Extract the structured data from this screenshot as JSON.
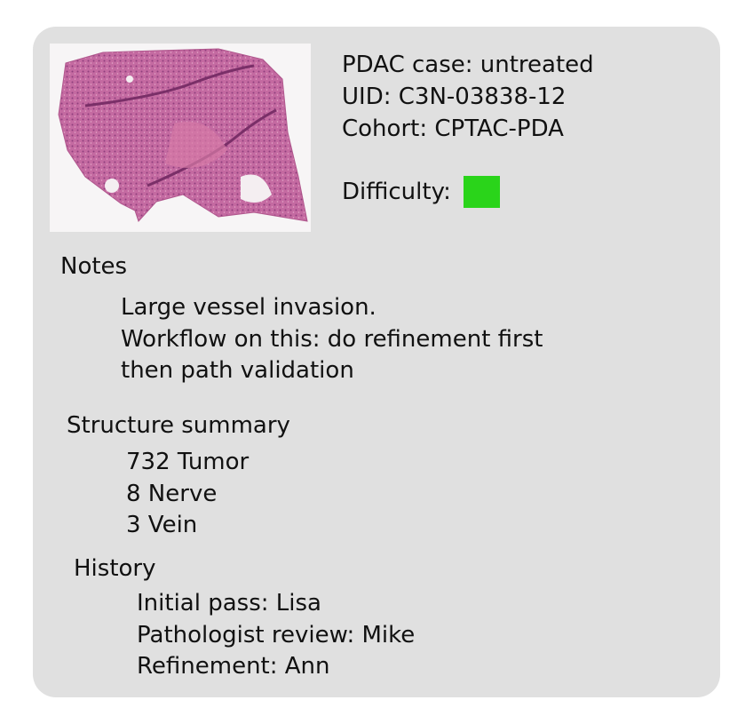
{
  "case": {
    "title": "PDAC case: untreated",
    "uid": "UID: C3N-03838-12",
    "cohort": "Cohort: CPTAC-PDA",
    "difficulty_label": "Difficulty:",
    "difficulty_color": "#2ad41a"
  },
  "thumbnail": {
    "icon": "tissue-slide-thumbnail",
    "tissue_color": "#c05f9a"
  },
  "notes": {
    "heading": "Notes",
    "lines": [
      "Large vessel invasion.",
      "Workflow on this: do refinement first",
      "then path validation"
    ]
  },
  "structure_summary": {
    "heading": "Structure summary",
    "items": [
      "732 Tumor",
      "8 Nerve",
      "3 Vein"
    ]
  },
  "history": {
    "heading": "History",
    "items": [
      "Initial pass: Lisa",
      "Pathologist review: Mike",
      "Refinement: Ann"
    ]
  }
}
